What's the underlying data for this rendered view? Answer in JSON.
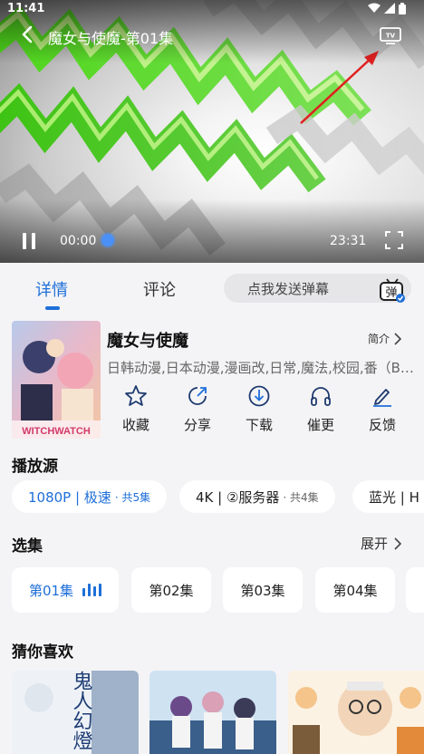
{
  "status_bar": {
    "time": "11:41",
    "icons": [
      "wifi-icon",
      "signal-icon",
      "battery-icon"
    ]
  },
  "player": {
    "title": "魔女与使魔-第01集",
    "current_time": "00:00",
    "total_time": "23:31",
    "progress": 0,
    "icons": [
      "back-icon",
      "tv-cast-icon",
      "pause-icon",
      "fullscreen-icon"
    ]
  },
  "tabs": {
    "items": [
      "详情",
      "评论"
    ],
    "active": "详情",
    "danmaku_placeholder": "点我发送弹幕",
    "danmaku_icon_text": "弹"
  },
  "show": {
    "title": "魔女与使魔",
    "intro_label": "简介",
    "tags": "日韩动漫,日本动漫,漫画改,日常,魔法,校园,番（B…",
    "poster_text": "WITCHWATCH",
    "actions": [
      {
        "label": "收藏",
        "icon": "star-icon"
      },
      {
        "label": "分享",
        "icon": "share-icon"
      },
      {
        "label": "下载",
        "icon": "download-icon"
      },
      {
        "label": "催更",
        "icon": "headphones-icon"
      },
      {
        "label": "反馈",
        "icon": "edit-icon"
      }
    ]
  },
  "sources": {
    "title": "播放源",
    "items": [
      {
        "name": "1080P | 极速",
        "count": "· 共5集",
        "selected": true
      },
      {
        "name": "4K | ②服务器",
        "count": "· 共4集",
        "selected": false
      },
      {
        "name": "蓝光 | H",
        "count": "",
        "selected": false
      }
    ]
  },
  "episodes": {
    "title": "选集",
    "expand_label": "展开",
    "items": [
      {
        "label": "第01集",
        "playing": true
      },
      {
        "label": "第02集",
        "playing": false
      },
      {
        "label": "第03集",
        "playing": false
      },
      {
        "label": "第04集",
        "playing": false
      }
    ]
  },
  "recommend": {
    "title": "猜你喜欢",
    "posters": [
      {
        "text": "鬼人幻燈"
      },
      {
        "text": ""
      },
      {
        "text": ""
      }
    ]
  },
  "colors": {
    "accent": "#1e6fd9",
    "background": "#f4f4f6",
    "card": "#ffffff"
  }
}
